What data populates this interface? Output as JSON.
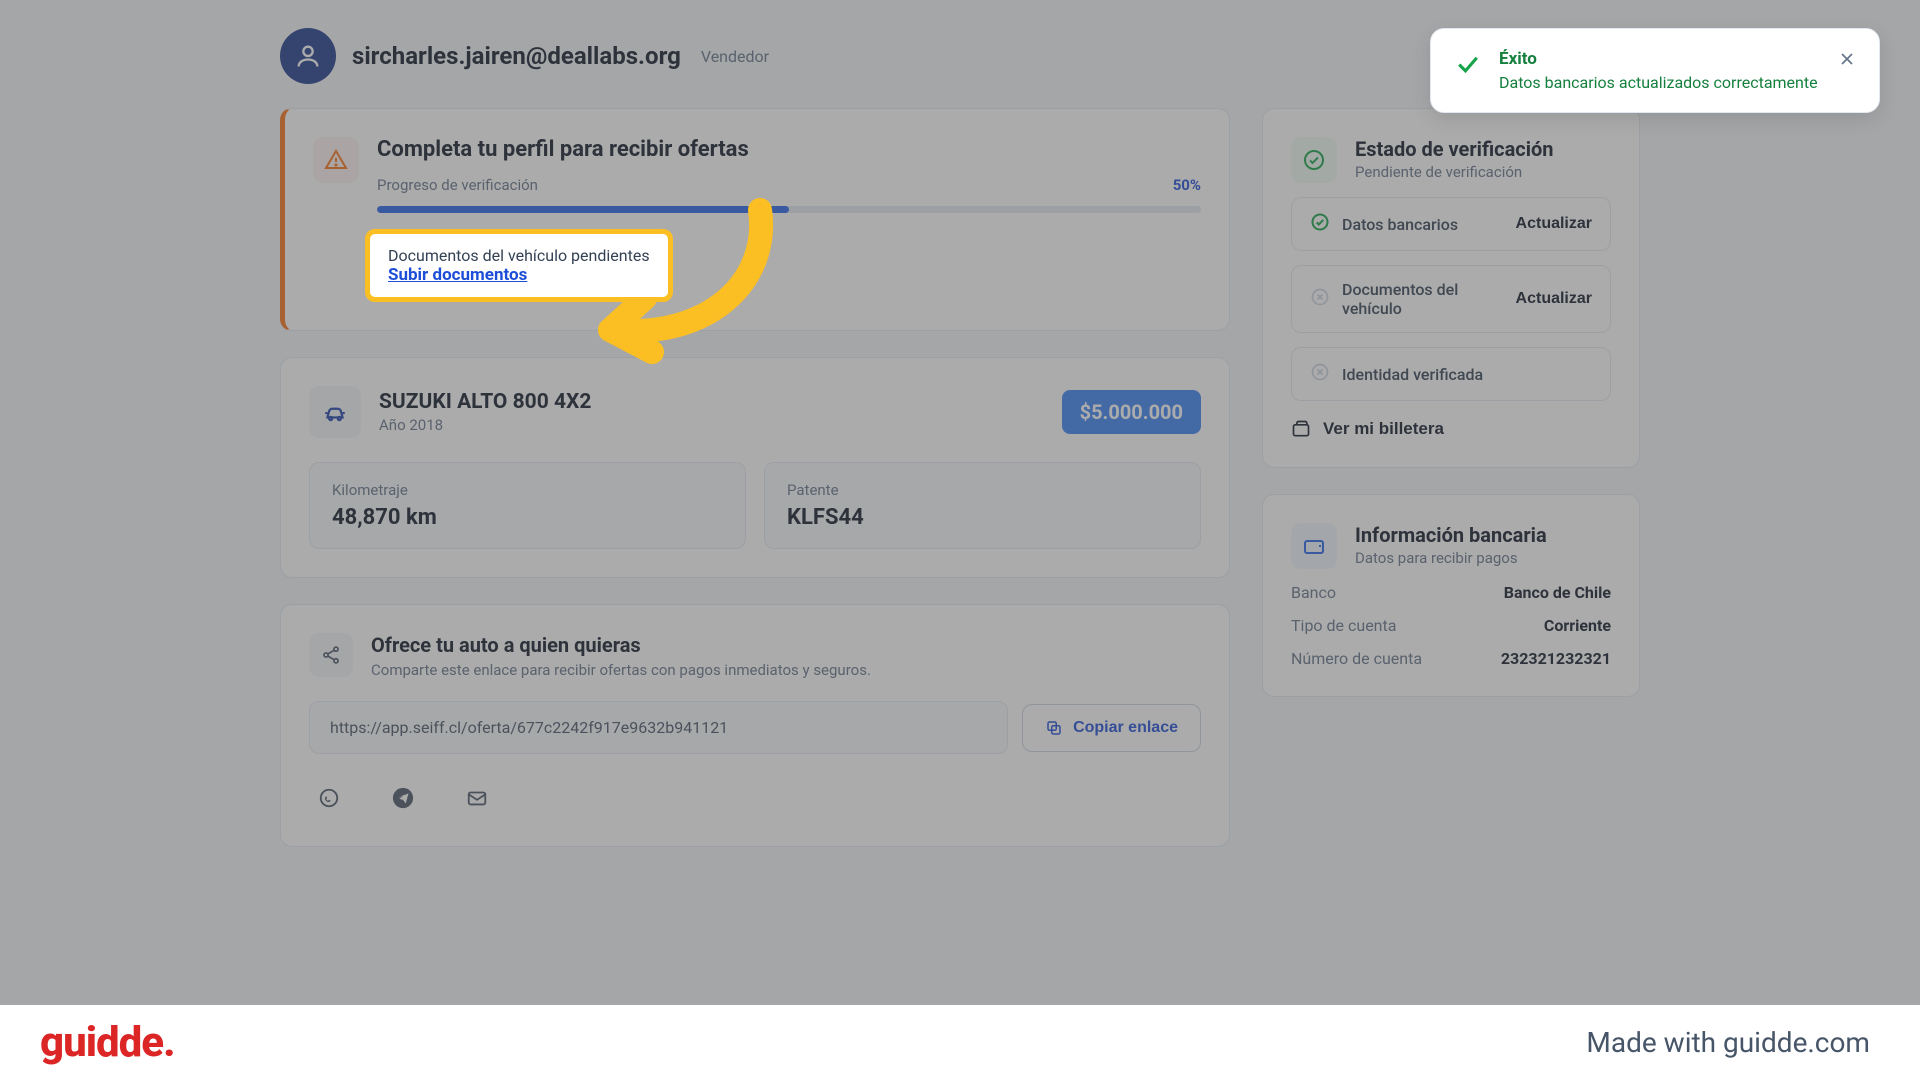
{
  "header": {
    "email": "sircharles.jairen@deallabs.org",
    "role": "Vendedor"
  },
  "profile_card": {
    "title": "Completa tu perfil para recibir ofertas",
    "progress_label": "Progreso de verificación",
    "progress_pct": "50%",
    "progress_value": 50,
    "pending_text": "Documentos del vehículo pendientes",
    "upload_link": "Subir documentos"
  },
  "vehicle": {
    "title": "SUZUKI ALTO 800 4X2",
    "subtitle": "Año 2018",
    "price": "$5.000.000",
    "stats": [
      {
        "label": "Kilometraje",
        "value": "48,870 km"
      },
      {
        "label": "Patente",
        "value": "KLFS44"
      }
    ]
  },
  "share": {
    "title": "Ofrece tu auto a quien quieras",
    "subtitle": "Comparte este enlace para recibir ofertas con pagos inmediatos y seguros.",
    "url": "https://app.seiff.cl/oferta/677c2242f917e9632b941121",
    "copy_label": "Copiar enlace"
  },
  "verification": {
    "title": "Estado de verificación",
    "subtitle": "Pendiente de verificación",
    "items": [
      {
        "label": "Datos bancarios",
        "action": "Actualizar",
        "status": "done"
      },
      {
        "label": "Documentos del vehículo",
        "action": "Actualizar",
        "status": "pending"
      },
      {
        "label": "Identidad verificada",
        "action": "",
        "status": "pending"
      }
    ],
    "wallet_label": "Ver mi billetera"
  },
  "bank_info": {
    "title": "Información bancaria",
    "subtitle": "Datos para recibir pagos",
    "rows": [
      {
        "label": "Banco",
        "value": "Banco de Chile"
      },
      {
        "label": "Tipo de cuenta",
        "value": "Corriente"
      },
      {
        "label": "Número de cuenta",
        "value": "232321232321"
      }
    ]
  },
  "toast": {
    "title": "Éxito",
    "message": "Datos bancarios actualizados correctamente"
  },
  "footer": {
    "logo": "guidde.",
    "made": "Made with guidde.com"
  }
}
